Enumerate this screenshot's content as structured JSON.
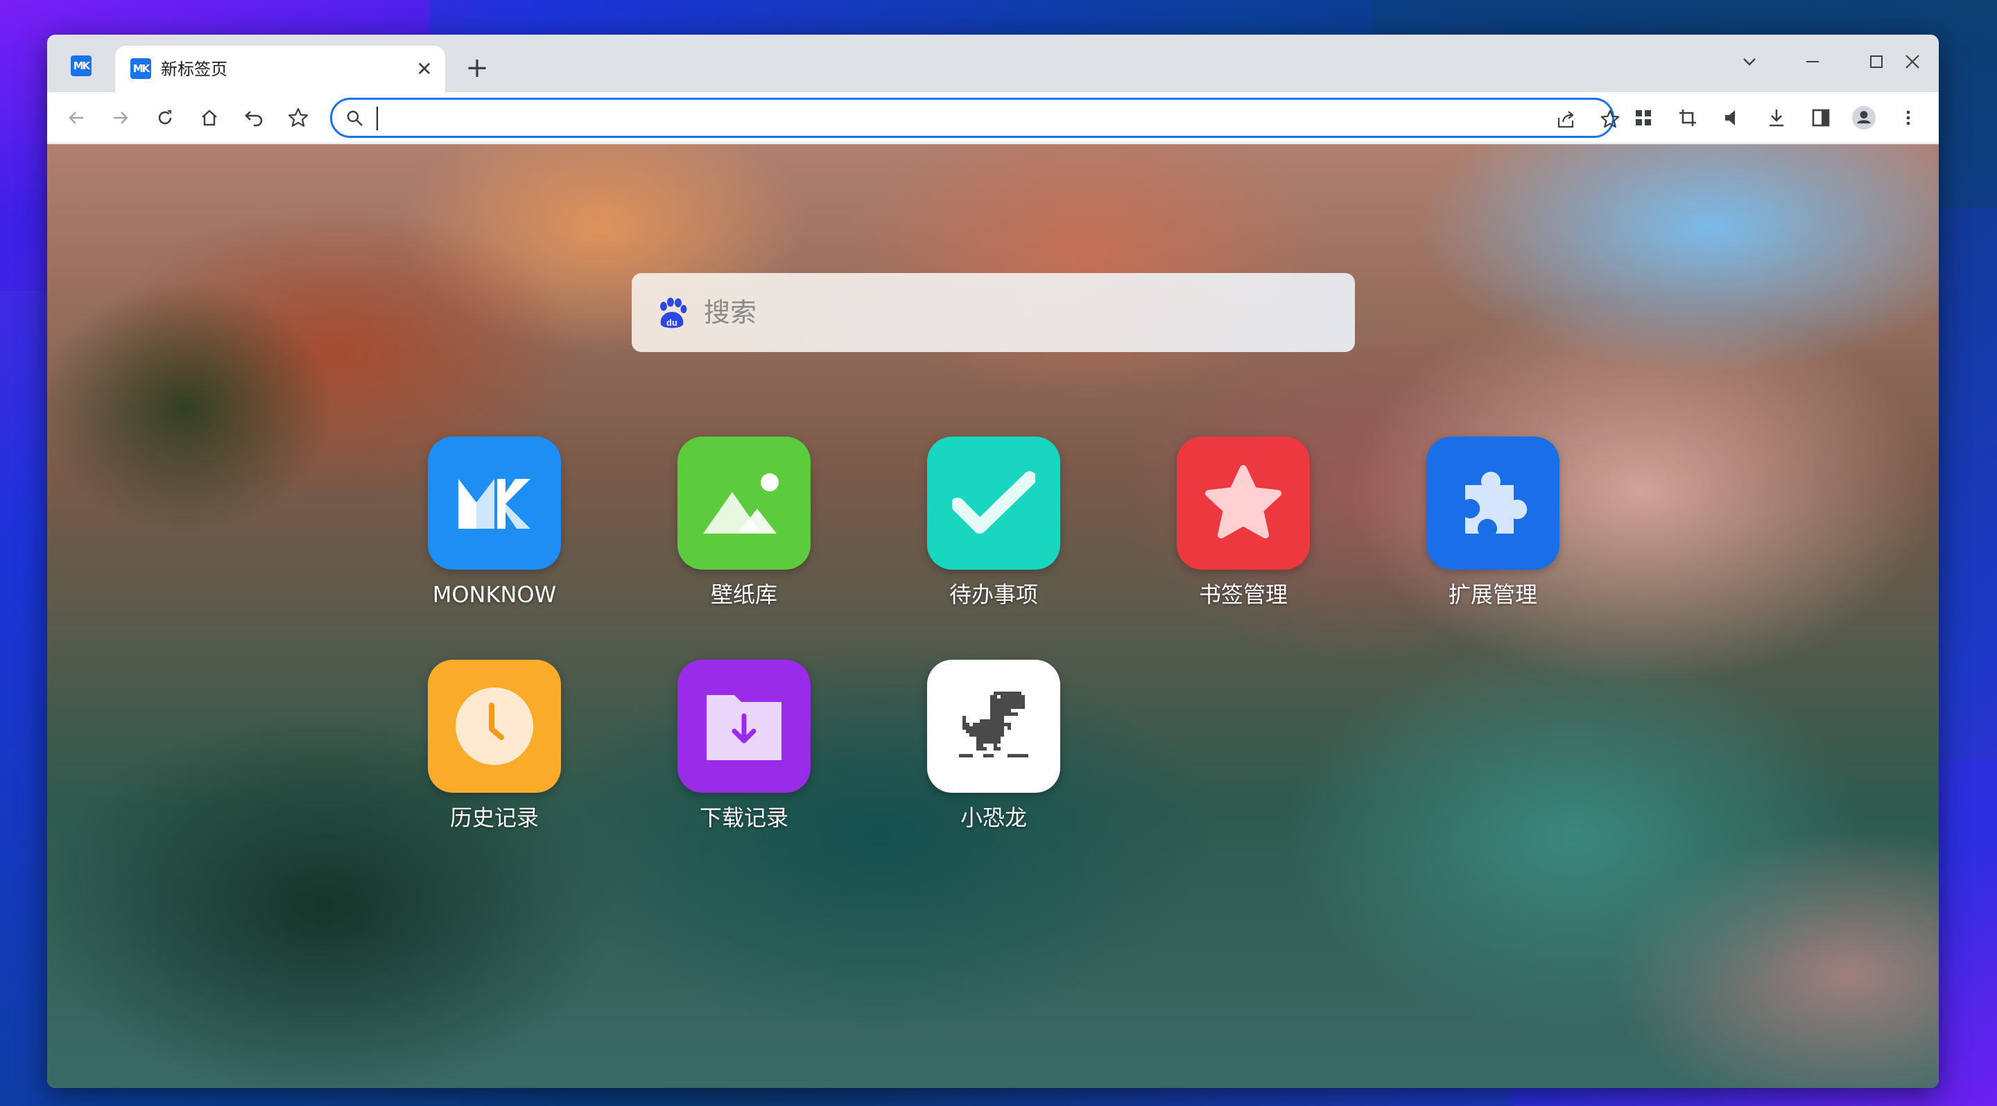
{
  "tab": {
    "title": "新标签页",
    "close_glyph": "✕"
  },
  "newtab_glyph": "+",
  "omnibox": {
    "value": ""
  },
  "search": {
    "placeholder": "搜索"
  },
  "apps": [
    {
      "label": "MONKNOW",
      "icon": "monknow-logo-icon",
      "color": "#1e8ef5"
    },
    {
      "label": "壁纸库",
      "icon": "wallpaper-icon",
      "color": "#5ccc3c"
    },
    {
      "label": "待办事项",
      "icon": "checkmark-icon",
      "color": "#18d6c0"
    },
    {
      "label": "书签管理",
      "icon": "star-icon",
      "color": "#ee3840"
    },
    {
      "label": "扩展管理",
      "icon": "puzzle-icon",
      "color": "#1a6fe8"
    },
    {
      "label": "历史记录",
      "icon": "clock-icon",
      "color": "#fbab2a"
    },
    {
      "label": "下载记录",
      "icon": "download-folder-icon",
      "color": "#9a2be8"
    },
    {
      "label": "小恐龙",
      "icon": "dino-icon",
      "color": "#ffffff"
    }
  ],
  "colors": {
    "accent": "#1a73e8",
    "tabstrip": "#dee1e6"
  }
}
